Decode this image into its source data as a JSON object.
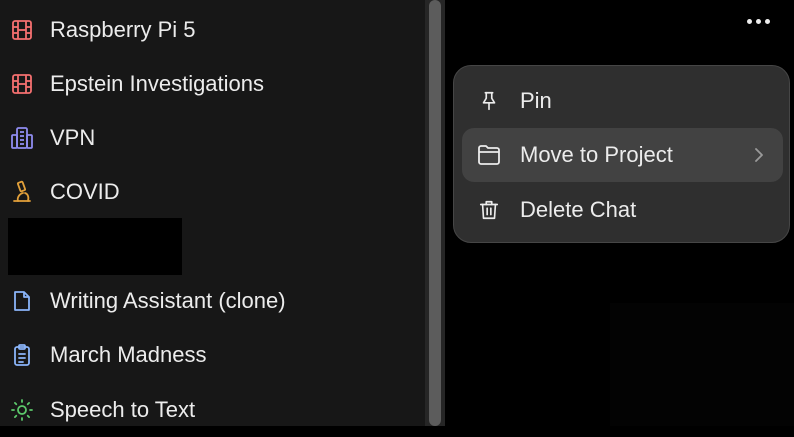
{
  "sidebar": {
    "items": [
      {
        "label": "Raspberry Pi 5",
        "icon": "film-icon",
        "color": "#f47070"
      },
      {
        "label": "Epstein Investigations",
        "icon": "film-icon",
        "color": "#f47070"
      },
      {
        "label": "VPN",
        "icon": "server-icon",
        "color": "#8f8cf0"
      },
      {
        "label": "COVID",
        "icon": "microscope-icon",
        "color": "#e2a03a"
      },
      {
        "label": "Writing Assistant (clone)",
        "icon": "document-icon",
        "color": "#8ab4f8"
      },
      {
        "label": "March Madness",
        "icon": "clipboard-icon",
        "color": "#8ab4f8"
      },
      {
        "label": "Speech to Text",
        "icon": "sun-icon",
        "color": "#5cc96b"
      }
    ]
  },
  "context_menu": {
    "items": [
      {
        "label": "Pin",
        "icon": "pin-icon"
      },
      {
        "label": "Move to Project",
        "icon": "folder-icon",
        "has_submenu": true,
        "highlighted": true
      },
      {
        "label": "Delete Chat",
        "icon": "trash-icon"
      }
    ]
  }
}
